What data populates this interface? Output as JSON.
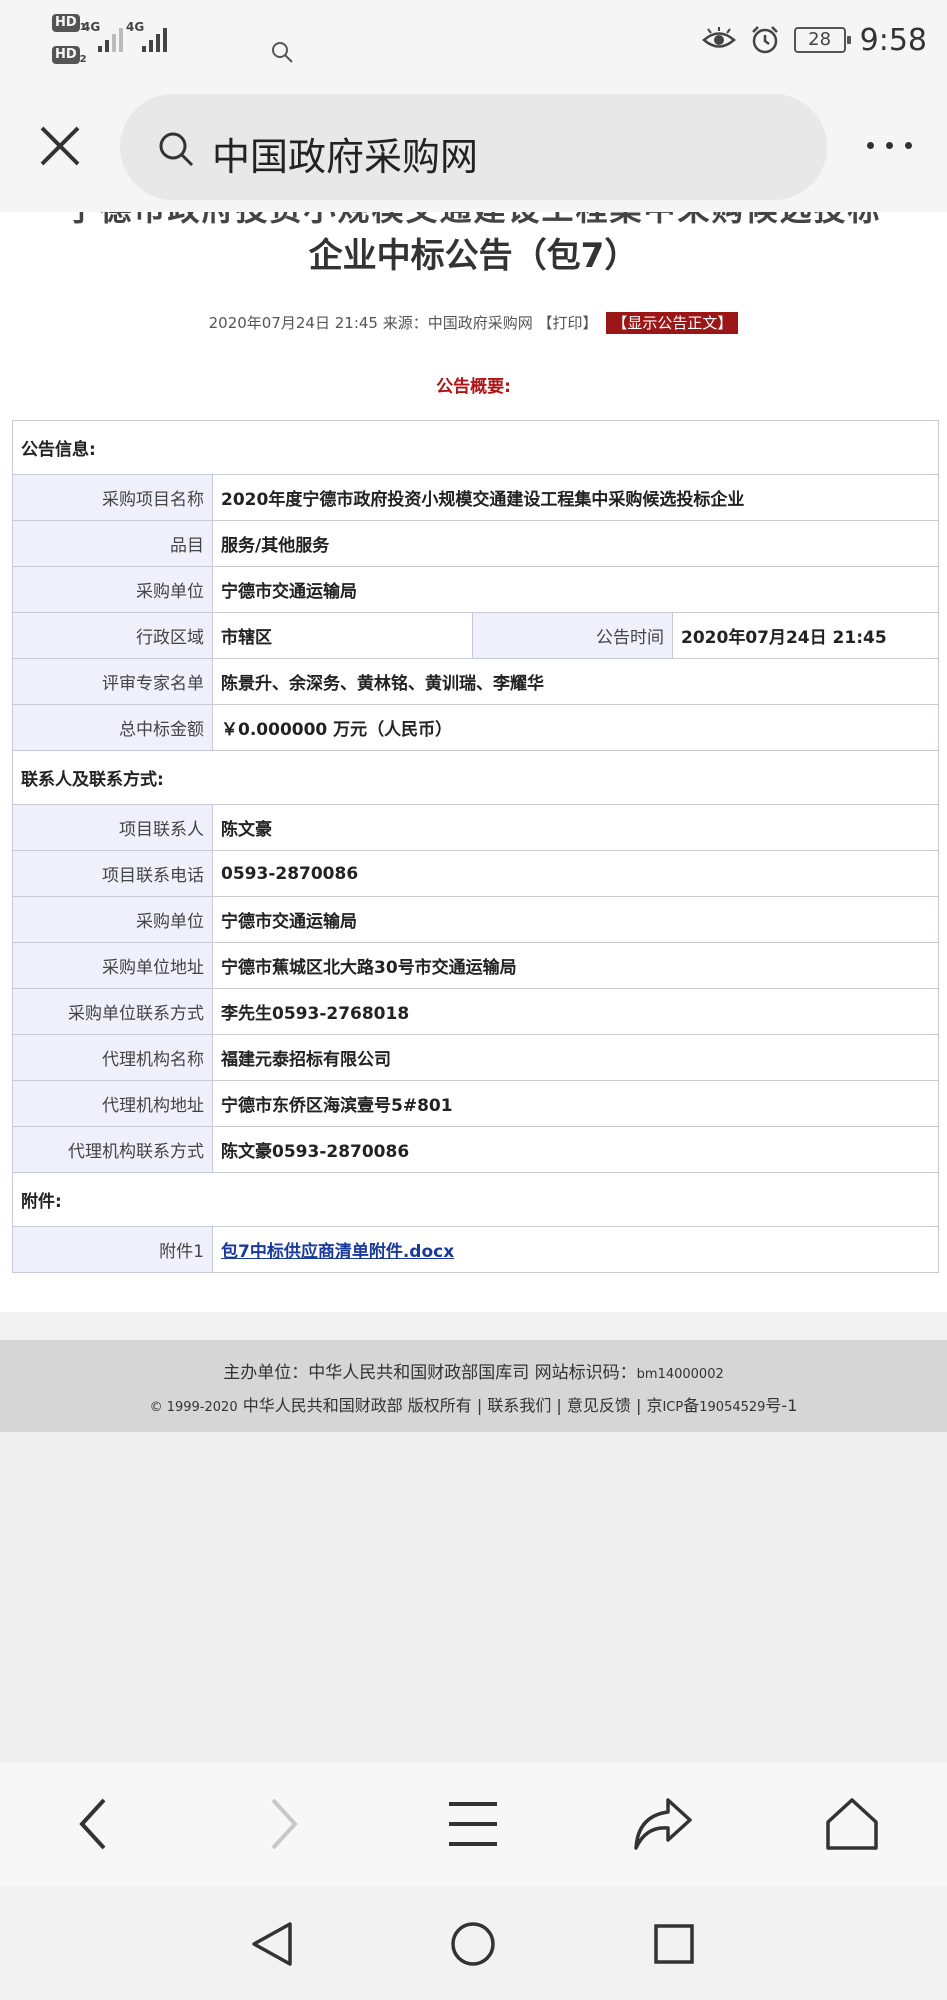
{
  "status_bar": {
    "hd1": "HD",
    "hd1_sub": "1",
    "hd2": "HD",
    "hd2_sub": "2",
    "net1": "4G",
    "net2": "4G",
    "battery": "28",
    "time": "9:58"
  },
  "browser": {
    "url_text": "中国政府采购网"
  },
  "page": {
    "title_clipped": "宁德市政府投资小规模交通建设工程集中采购候选投标",
    "title": "企业中标公告（包7）",
    "meta_date": "2020年07月24日 21:45",
    "meta_source": "来源：中国政府采购网",
    "meta_print": "【打印】",
    "meta_show": "【显示公告正文】",
    "summary_title": "公告概要:",
    "section_info": "公告信息:",
    "section_contact": "联系人及联系方式:",
    "section_attach": "附件:",
    "rows_info": [
      {
        "label": "采购项目名称",
        "value": "2020年度宁德市政府投资小规模交通建设工程集中采购候选投标企业"
      },
      {
        "label": "品目",
        "value": "服务/其他服务"
      },
      {
        "label": "采购单位",
        "value": "宁德市交通运输局"
      }
    ],
    "region_label": "行政区域",
    "region_value": "市辖区",
    "time_label": "公告时间",
    "time_value": "2020年07月24日 21:45",
    "rows_info2": [
      {
        "label": "评审专家名单",
        "value": "陈景升、余深务、黄林铭、黄训瑞、李耀华"
      },
      {
        "label": "总中标金额",
        "value": "￥0.000000 万元（人民币）"
      }
    ],
    "rows_contact": [
      {
        "label": "项目联系人",
        "value": "陈文豪"
      },
      {
        "label": "项目联系电话",
        "value": "0593-2870086"
      },
      {
        "label": "采购单位",
        "value": "宁德市交通运输局"
      },
      {
        "label": "采购单位地址",
        "value": "宁德市蕉城区北大路30号市交通运输局"
      },
      {
        "label": "采购单位联系方式",
        "value": "李先生0593-2768018"
      },
      {
        "label": "代理机构名称",
        "value": "福建元泰招标有限公司"
      },
      {
        "label": "代理机构地址",
        "value": "宁德市东侨区海滨壹号5#801"
      },
      {
        "label": "代理机构联系方式",
        "value": "陈文豪0593-2870086"
      }
    ],
    "attach_label": "附件1",
    "attach_link": "包7中标供应商清单附件.docx"
  },
  "footer": {
    "line1_main": "主办单位：中华人民共和国财政部国库司 网站标识码：",
    "line1_code": "bm14000002",
    "line2_prefix": "© 1999-2020",
    "line2_main": "中华人民共和国财政部 版权所有 | 联系我们 | 意见反馈 | 京",
    "line2_icp": "ICP",
    "line2_bei": "备",
    "line2_num": "19054529",
    "line2_suffix": "号-1"
  },
  "icons": {
    "close": "close-icon",
    "search": "search-icon",
    "more": "more-icon",
    "back": "back-icon",
    "forward": "forward-icon",
    "menu": "menu-icon",
    "share": "share-icon",
    "home": "home-icon"
  }
}
